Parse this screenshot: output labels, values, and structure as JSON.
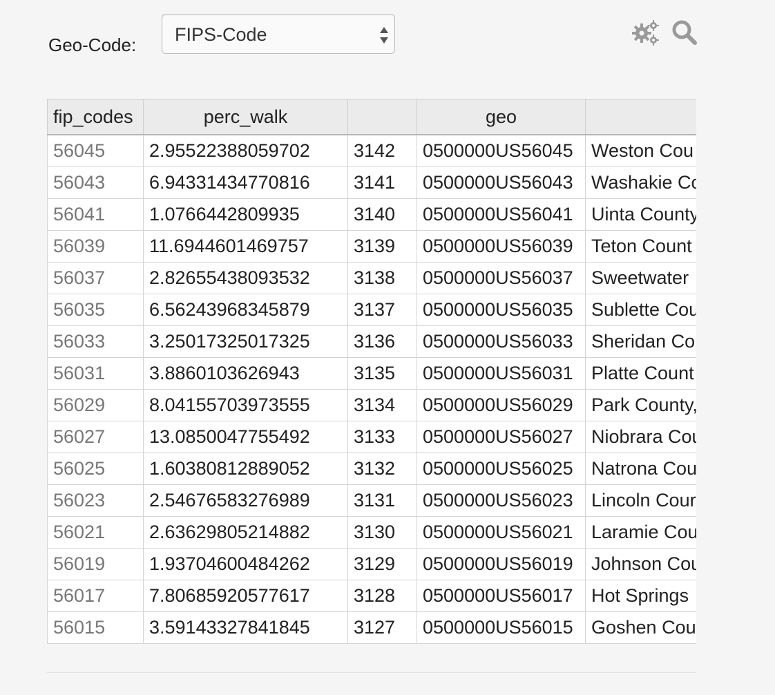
{
  "geo_selector": {
    "label": "Geo-Code:",
    "value": "FIPS-Code"
  },
  "toolbar": {
    "settings_icon": "gears-icon",
    "search_icon": "search-icon"
  },
  "table": {
    "columns": [
      "fip_codes",
      "perc_walk",
      "",
      "geo",
      ""
    ],
    "rows": [
      [
        "56045",
        "2.95522388059702",
        "3142",
        "0500000US56045",
        "Weston Cou"
      ],
      [
        "56043",
        "6.94331434770816",
        "3141",
        "0500000US56043",
        "Washakie Co"
      ],
      [
        "56041",
        "1.0766442809935",
        "3140",
        "0500000US56041",
        "Uinta County"
      ],
      [
        "56039",
        "11.6944601469757",
        "3139",
        "0500000US56039",
        "Teton Count"
      ],
      [
        "56037",
        "2.82655438093532",
        "3138",
        "0500000US56037",
        "Sweetwater"
      ],
      [
        "56035",
        "6.56243968345879",
        "3137",
        "0500000US56035",
        "Sublette Cou"
      ],
      [
        "56033",
        "3.25017325017325",
        "3136",
        "0500000US56033",
        "Sheridan Co"
      ],
      [
        "56031",
        "3.8860103626943",
        "3135",
        "0500000US56031",
        "Platte Count"
      ],
      [
        "56029",
        "8.04155703973555",
        "3134",
        "0500000US56029",
        "Park County,"
      ],
      [
        "56027",
        "13.0850047755492",
        "3133",
        "0500000US56027",
        "Niobrara Cou"
      ],
      [
        "56025",
        "1.60380812889052",
        "3132",
        "0500000US56025",
        "Natrona Cou"
      ],
      [
        "56023",
        "2.54676583276989",
        "3131",
        "0500000US56023",
        "Lincoln Cour"
      ],
      [
        "56021",
        "2.63629805214882",
        "3130",
        "0500000US56021",
        "Laramie Cou"
      ],
      [
        "56019",
        "1.93704600484262",
        "3129",
        "0500000US56019",
        "Johnson Cou"
      ],
      [
        "56017",
        "7.80685920577617",
        "3128",
        "0500000US56017",
        "Hot Springs"
      ],
      [
        "56015",
        "3.59143327841845",
        "3127",
        "0500000US56015",
        "Goshen Cou"
      ]
    ]
  }
}
